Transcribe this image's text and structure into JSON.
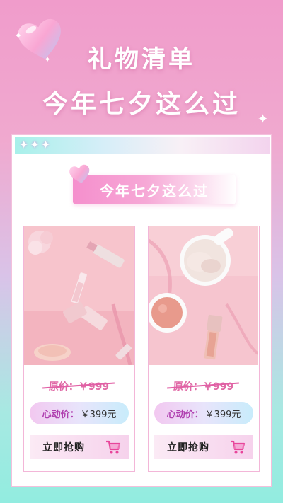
{
  "header": {
    "title_line1": "礼物清单",
    "title_line2": "今年七夕这么过"
  },
  "card": {
    "topbar_stars": "✦✦✦",
    "banner_title": "今年七夕这么过"
  },
  "products": [
    {
      "original_price_label": "原价：￥999",
      "sale_label": "心动价：",
      "sale_price": "￥399元",
      "buy_label": "立即抢购"
    },
    {
      "original_price_label": "原价：￥999",
      "sale_label": "心动价：",
      "sale_price": "￥399元",
      "buy_label": "立即抢购"
    }
  ],
  "icons": {
    "heart": "heart-icon",
    "sparkle": "sparkle-icon",
    "cart": "shopping-cart-icon"
  },
  "colors": {
    "accent_pink": "#f58fcd",
    "price_pink": "#e06aa6",
    "sale_purple": "#b040b0",
    "mint": "#92ece0"
  }
}
